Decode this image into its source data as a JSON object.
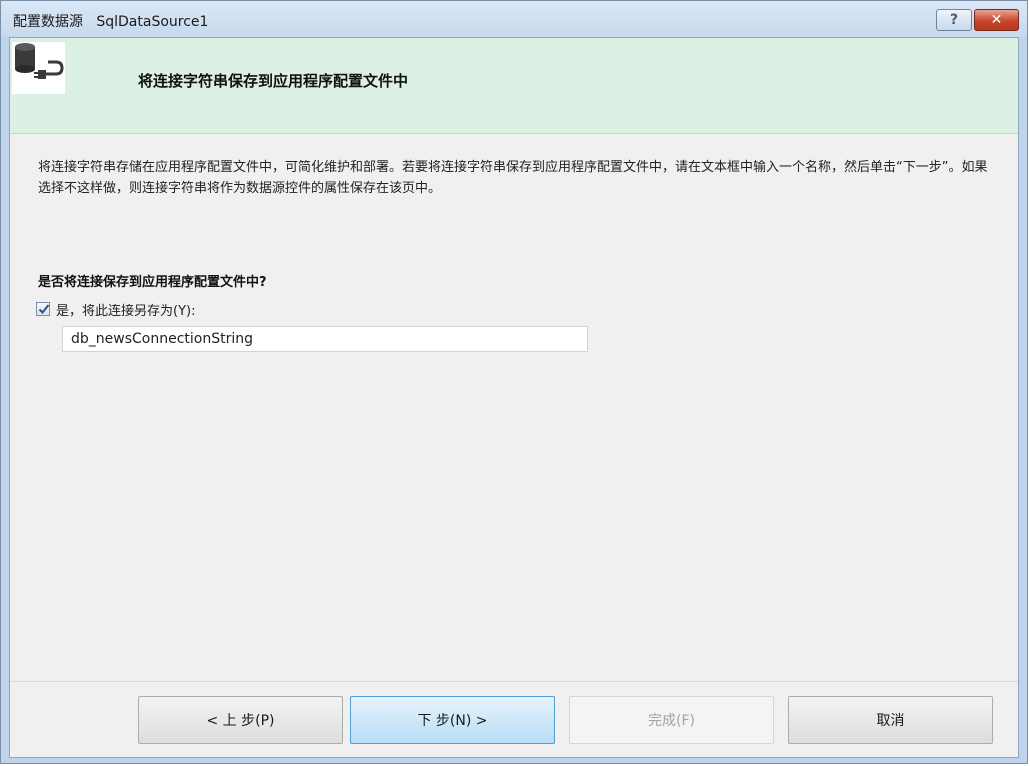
{
  "window": {
    "title": "配置数据源   SqlDataSource1",
    "help_label": "?",
    "close_label": "✕"
  },
  "header": {
    "title": "将连接字符串保存到应用程序配置文件中",
    "icon": "database-connection-icon"
  },
  "description": "将连接字符串存储在应用程序配置文件中，可简化维护和部署。若要将连接字符串保存到应用程序配置文件中，请在文本框中输入一个名称，然后单击“下一步”。如果选择不这样做，则连接字符串将作为数据源控件的属性保存在该页中。",
  "question": "是否将连接保存到应用程序配置文件中?",
  "save_checkbox": {
    "label": "是，将此连接另存为(Y):",
    "checked": true
  },
  "connection_name": {
    "value": "db_newsConnectionString"
  },
  "buttons": {
    "back": "< 上 步(P)",
    "next": "下 步(N) >",
    "finish": "完成(F)",
    "cancel": "取消"
  },
  "colors": {
    "header_bg": "#dcf1e3",
    "next_button_accent": "#b9ddf6",
    "close_button": "#c7462b"
  }
}
